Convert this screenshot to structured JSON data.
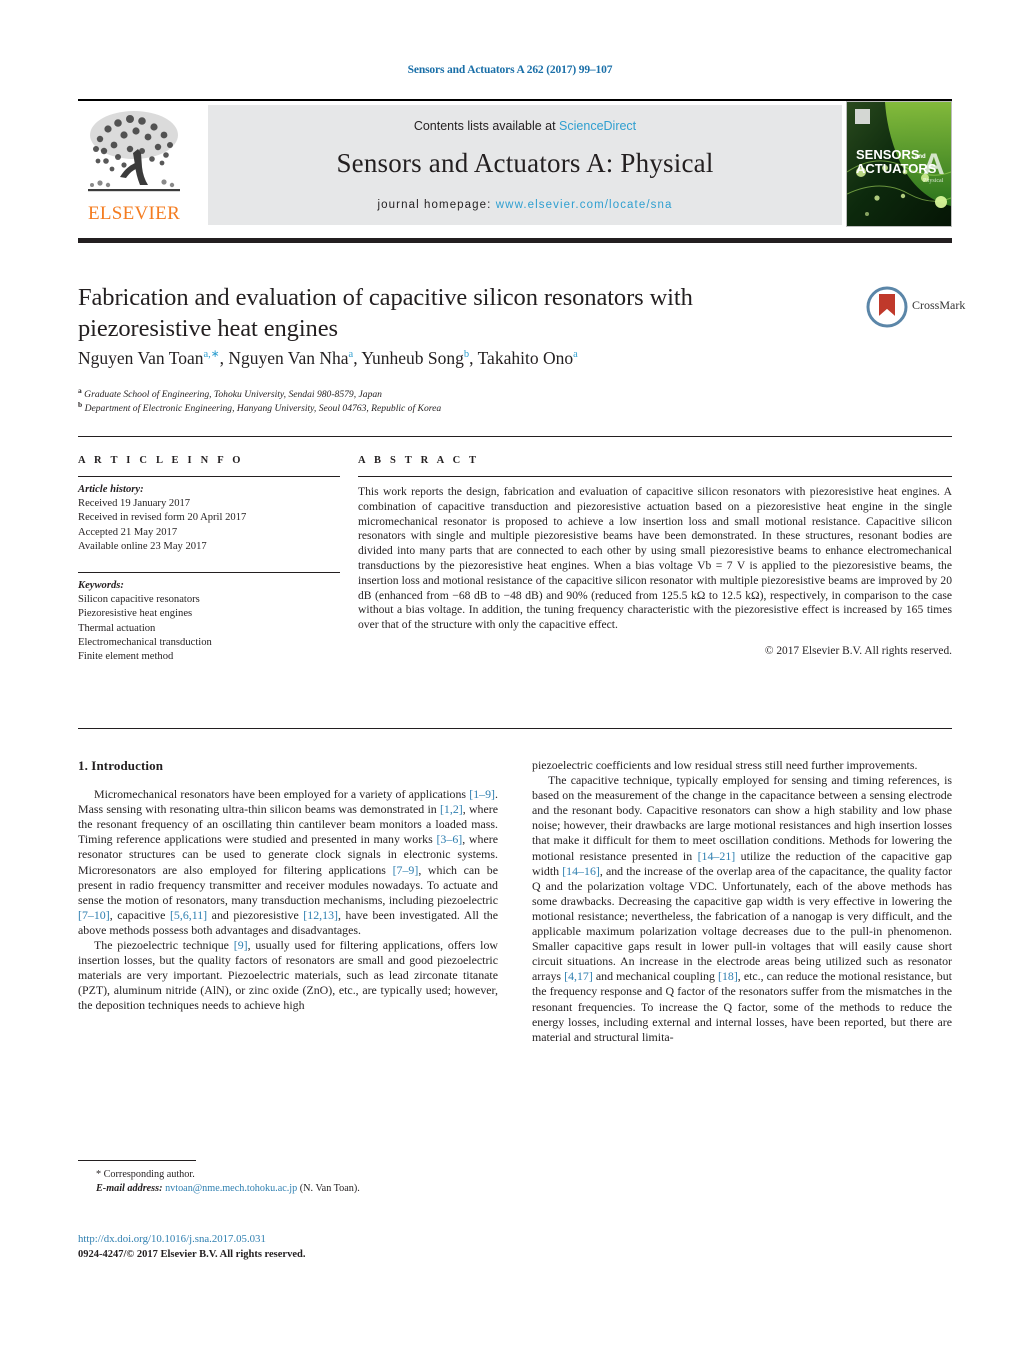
{
  "running_head": "Sensors and Actuators A 262 (2017) 99–107",
  "masthead": {
    "publisher_name": "ELSEVIER",
    "contents_prefix": "Contents lists available at ",
    "contents_link": "ScienceDirect",
    "journal_title": "Sensors and Actuators A: Physical",
    "homepage_prefix": "journal homepage: ",
    "homepage_url": "www.elsevier.com/locate/sna",
    "cover_line1": "SENSORS",
    "cover_and": "and",
    "cover_line2": "ACTUATORS",
    "cover_letter": "A",
    "cover_sub": "Physical"
  },
  "article": {
    "title": "Fabrication and evaluation of capacitive silicon resonators with piezoresistive heat engines",
    "crossmark_label": "CrossMark",
    "authors_html": "Nguyen Van Toan<sup>a,∗</sup>, Nguyen Van Nha<sup>a</sup>, Yunheub Song<sup>b</sup>, Takahito Ono<sup>a</sup>",
    "affiliation_a": "Graduate School of Engineering, Tohoku University, Sendai 980-8579, Japan",
    "affiliation_b": "Department of Electronic Engineering, Hanyang University, Seoul 04763, Republic of Korea"
  },
  "info": {
    "heading": "A R T I C L E   I N F O",
    "history_label": "Article history:",
    "history": [
      "Received 19 January 2017",
      "Received in revised form 20 April 2017",
      "Accepted 21 May 2017",
      "Available online 23 May 2017"
    ],
    "keywords_label": "Keywords:",
    "keywords": [
      "Silicon capacitive resonators",
      "Piezoresistive heat engines",
      "Thermal actuation",
      "Electromechanical transduction",
      "Finite element method"
    ]
  },
  "abstract": {
    "heading": "A B S T R A C T",
    "body": "This work reports the design, fabrication and evaluation of capacitive silicon resonators with piezoresistive heat engines. A combination of capacitive transduction and piezoresistive actuation based on a piezoresistive heat engine in the single micromechanical resonator is proposed to achieve a low insertion loss and small motional resistance. Capacitive silicon resonators with single and multiple piezoresistive beams have been demonstrated. In these structures, resonant bodies are divided into many parts that are connected to each other by using small piezoresistive beams to enhance electromechanical transductions by the piezoresistive heat engines. When a bias voltage Vb = 7 V is applied to the piezoresistive beams, the insertion loss and motional resistance of the capacitive silicon resonator with multiple piezoresistive beams are improved by 20 dB (enhanced from −68 dB to −48 dB) and 90% (reduced from 125.5 kΩ to 12.5 kΩ), respectively, in comparison to the case without a bias voltage. In addition, the tuning frequency characteristic with the piezoresistive effect is increased by 165 times over that of the structure with only the capacitive effect.",
    "copyright": "© 2017 Elsevier B.V. All rights reserved."
  },
  "body": {
    "section_heading": "1.  Introduction",
    "left_paragraphs": [
      "Micromechanical resonators have been employed for a variety of applications [1–9]. Mass sensing with resonating ultra-thin silicon beams was demonstrated in [1,2], where the resonant frequency of an oscillating thin cantilever beam monitors a loaded mass. Timing reference applications were studied and presented in many works [3–6], where resonator structures can be used to generate clock signals in electronic systems. Microresonators are also employed for filtering applications [7–9], which can be present in radio frequency transmitter and receiver modules nowadays. To actuate and sense the motion of resonators, many transduction mechanisms, including piezoelectric [7–10], capacitive [5,6,11] and piezoresistive [12,13], have been investigated. All the above methods possess both advantages and disadvantages.",
      "The piezoelectric technique [9], usually used for filtering applications, offers low insertion losses, but the quality factors of resonators are small and good piezoelectric materials are very important. Piezoelectric materials, such as lead zirconate titanate (PZT), aluminum nitride (AlN), or zinc oxide (ZnO), etc., are typically used; however, the deposition techniques needs to achieve high"
    ],
    "right_paragraphs": [
      "piezoelectric coefficients and low residual stress still need further improvements.",
      "The capacitive technique, typically employed for sensing and timing references, is based on the measurement of the change in the capacitance between a sensing electrode and the resonant body. Capacitive resonators can show a high stability and low phase noise; however, their drawbacks are large motional resistances and high insertion losses that make it difficult for them to meet oscillation conditions. Methods for lowering the motional resistance presented in [14–21] utilize the reduction of the capacitive gap width [14–16], and the increase of the overlap area of the capacitance, the quality factor Q and the polarization voltage VDC. Unfortunately, each of the above methods has some drawbacks. Decreasing the capacitive gap width is very effective in lowering the motional resistance; nevertheless, the fabrication of a nanogap is very difficult, and the applicable maximum polarization voltage decreases due to the pull-in phenomenon. Smaller capacitive gaps result in lower pull-in voltages that will easily cause short circuit situations. An increase in the electrode areas being utilized such as resonator arrays [4,17] and mechanical coupling [18], etc., can reduce the motional resistance, but the frequency response and Q factor of the resonators suffer from the mismatches in the resonant frequencies. To increase the Q factor, some of the methods to reduce the energy losses, including external and internal losses, have been reported, but there are material and structural limita-"
    ]
  },
  "footer": {
    "corresponding_marker": "*",
    "corresponding_text": "Corresponding author.",
    "email_label": "E-mail address:",
    "email": "nvtoan@nme.mech.tohoku.ac.jp",
    "email_owner": "(N. Van Toan).",
    "doi_url": "http://dx.doi.org/10.1016/j.sna.2017.05.031",
    "issn_line": "0924-4247/© 2017 Elsevier B.V. All rights reserved."
  },
  "colors": {
    "link": "#2f7fb0",
    "science_direct": "#2f9fd0",
    "elsevier_orange": "#f47c20",
    "grey_box": "#e6e7e8"
  }
}
